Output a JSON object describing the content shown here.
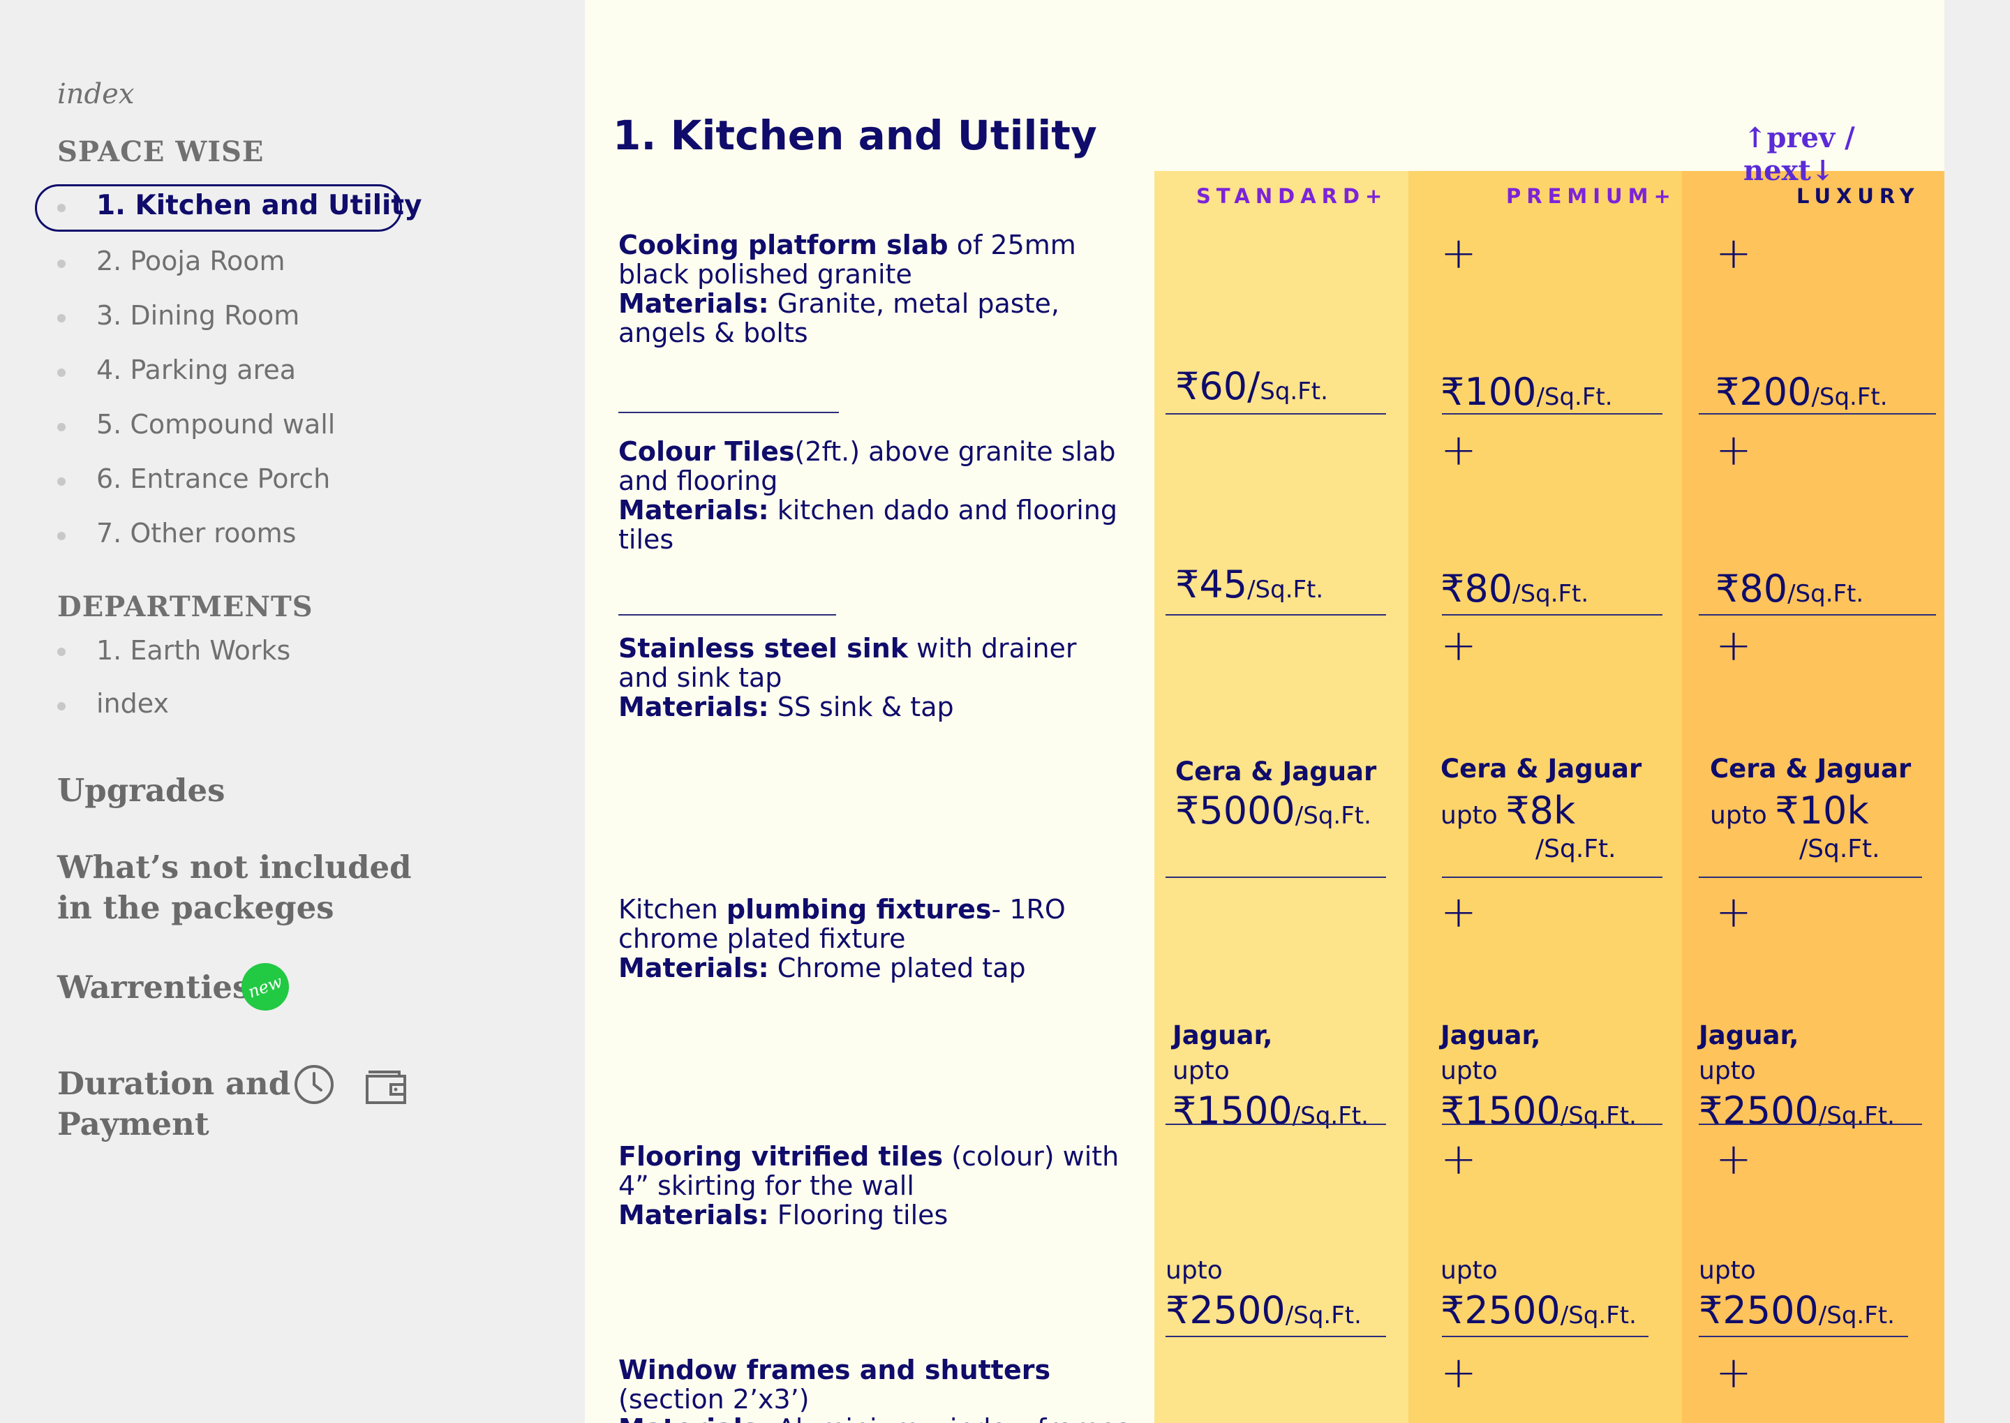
{
  "sidebar": {
    "index_label": "index",
    "space_wise_heading": "SPACE WISE",
    "space_items": [
      "1. Kitchen and Utility",
      "2. Pooja Room",
      "3. Dining Room",
      "4. Parking area",
      "5. Compound wall",
      "6. Entrance Porch",
      "7. Other rooms"
    ],
    "departments_heading": "DEPARTMENTS",
    "department_items": [
      "1. Earth Works",
      "index"
    ],
    "upgrades": "Upgrades",
    "not_included_1": "What’s not included",
    "not_included_2": "in the packeges",
    "warranties": "Warrenties",
    "new_badge": "new",
    "duration_1": "Duration and",
    "duration_2": "Payment"
  },
  "main": {
    "title": "1. Kitchen and Utility",
    "nav": "↑prev / next↓",
    "columns": [
      "STANDARD+",
      "PREMIUM+",
      "LUXURY"
    ],
    "features": [
      {
        "bold": "Cooking platform slab",
        "text": " of 25mm black polished granite",
        "mat_label": "Materials:",
        "mat": " Granite, metal paste, angels & bolts"
      },
      {
        "bold": "Colour Tiles",
        "text": "(2ft.) above granite slab and flooring",
        "mat_label": "Materials:",
        "mat": " kitchen dado and flooring tiles"
      },
      {
        "bold": "Stainless steel sink",
        "text": " with drainer and sink tap",
        "mat_label": "Materials:",
        "mat": " SS sink & tap"
      },
      {
        "pre": "Kitchen ",
        "bold": "plumbing fixtures",
        "text": "- 1RO chrome plated fixture",
        "mat_label": "Materials:",
        "mat": " Chrome plated tap"
      },
      {
        "bold": "Flooring vitrified tiles",
        "text": " (colour) with 4” skirting for the wall",
        "mat_label": "Materials:",
        "mat": " Flooring tiles"
      },
      {
        "bold": "Window frames and shutters",
        "text": " (section 2’x3’)",
        "mat_label": "Materials:",
        "mat": " Aluminium window frames"
      }
    ],
    "row1": {
      "std": "₹60/",
      "std_unit": "Sq.Ft.",
      "pre": "₹100",
      "pre_unit": "/Sq.Ft.",
      "lux": "₹200",
      "lux_unit": "/Sq.Ft."
    },
    "row2": {
      "std": "₹45",
      "std_unit": "/Sq.Ft.",
      "pre": "₹80",
      "pre_unit": "/Sq.Ft.",
      "lux": "₹80",
      "lux_unit": "/Sq.Ft."
    },
    "row3": {
      "std_brand": "Cera & Jaguar",
      "std_price": "₹5000",
      "std_unit": "/Sq.Ft.",
      "pre_brand": "Cera & Jaguar",
      "pre_upto": "upto ",
      "pre_price": "₹8k",
      "pre_unit": "/Sq.Ft.",
      "lux_brand": "Cera & Jaguar",
      "lux_upto": "upto ",
      "lux_price": "₹10k",
      "lux_unit": "/Sq.Ft."
    },
    "row4": {
      "brand": "Jaguar,",
      "upto": "upto",
      "std_price": "₹1500",
      "std_unit": "/Sq.Ft.",
      "pre_price": "₹1500",
      "pre_unit": "/Sq.Ft.",
      "lux_price": "₹2500",
      "lux_unit": "/Sq.Ft."
    },
    "row5": {
      "upto": "upto",
      "price": "₹2500",
      "unit": "/Sq.Ft."
    },
    "plus": "+"
  },
  "colors": {
    "ink": "#0f0c6b",
    "accent": "#5b2bd6",
    "standard_bg": "#fde38a",
    "premium_bg": "#fdd46a",
    "luxury_bg": "#fec35a",
    "badge": "#22c943"
  }
}
